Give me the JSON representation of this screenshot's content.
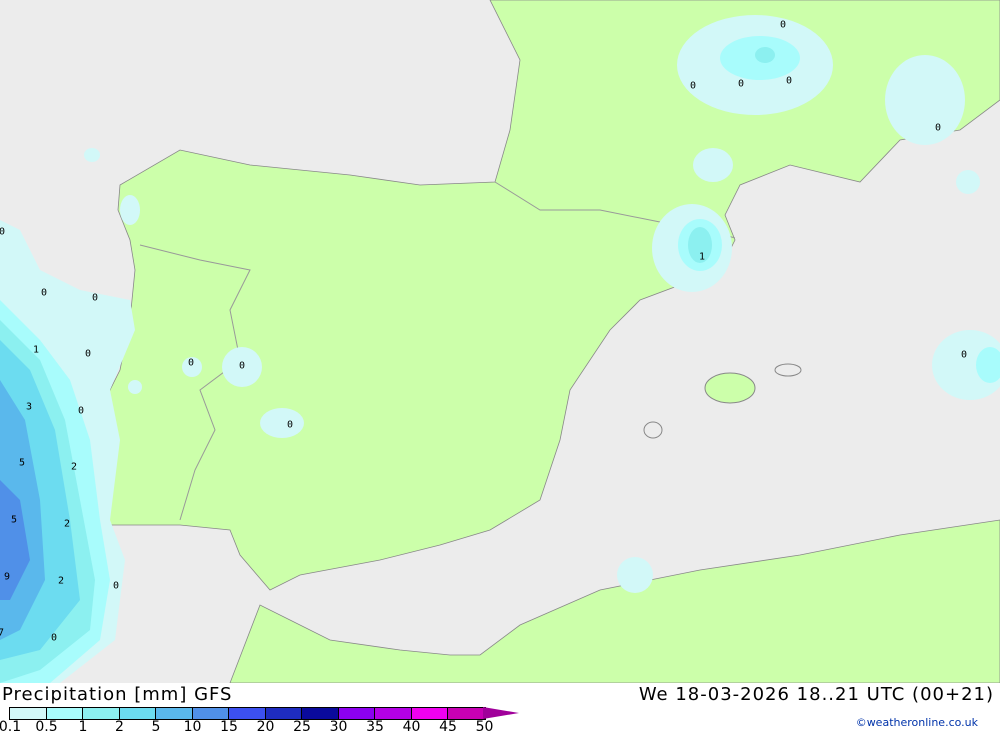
{
  "title": "Precipitation [mm] GFS",
  "datetime": "We 18-03-2026 18..21 UTC (00+21)",
  "credit": "©weatheronline.co.uk",
  "colors": {
    "sea": "#ececec",
    "land": "#ccffaa",
    "border": "#999999"
  },
  "legend": {
    "ticks": [
      "0.1",
      "0.5",
      "1",
      "2",
      "5",
      "10",
      "15",
      "20",
      "25",
      "30",
      "35",
      "40",
      "45",
      "50"
    ],
    "colors": [
      "#d2f8f8",
      "#a8fcfc",
      "#8cf0f0",
      "#6cdcf0",
      "#5ab8ec",
      "#5090e8",
      "#3c50f0",
      "#1e2cc0",
      "#0a0a9c",
      "#8c00f0",
      "#b400e6",
      "#f000f0",
      "#c800b4"
    ]
  },
  "map_labels": [
    "0",
    "0",
    "0",
    "0",
    "0",
    "1",
    "0",
    "0",
    "0",
    "1",
    "0",
    "0",
    "0",
    "3",
    "0",
    "5",
    "2",
    "5",
    "2",
    "9",
    "2",
    "0",
    "7",
    "0",
    "0",
    "0"
  ]
}
